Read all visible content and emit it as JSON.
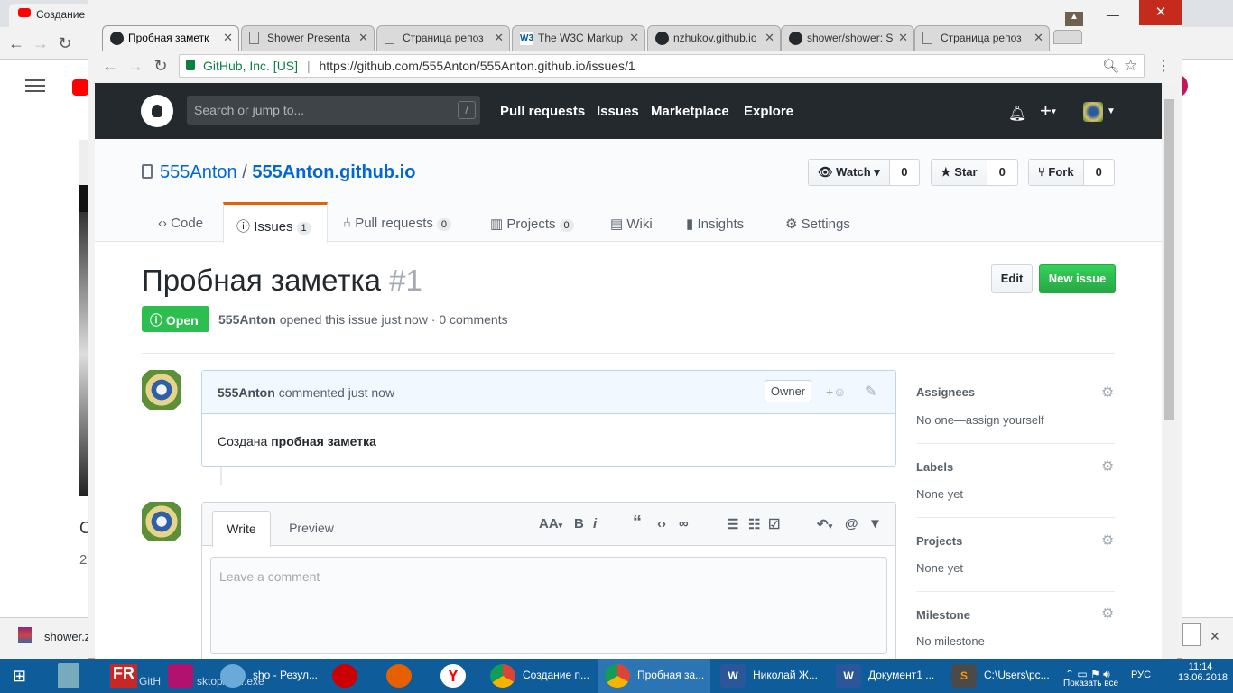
{
  "bg": {
    "tab_title": "Создание",
    "download_file": "shower.z",
    "download_file2": "GitH",
    "download_file3": "sktop/et....exe",
    "left_text_c": "C",
    "left_text_2": "2"
  },
  "window": {
    "tabs": [
      {
        "label": "Пробная заметк",
        "icon": "github-icon"
      },
      {
        "label": "Shower Presenta",
        "icon": "page-icon"
      },
      {
        "label": "Страница репоз",
        "icon": "page-icon"
      },
      {
        "label": "The W3C Markup",
        "icon": "w3c-icon"
      },
      {
        "label": "nzhukov.github.io",
        "icon": "github-icon"
      },
      {
        "label": "shower/shower: S",
        "icon": "github-icon"
      },
      {
        "label": "Страница репоз",
        "icon": "page-icon"
      }
    ],
    "close_symbol": "✕",
    "controls": {
      "minimize": "—",
      "maximize": "☐",
      "close": "✕",
      "user": "👤"
    }
  },
  "omnibox": {
    "secure_label": "GitHub, Inc. [US]",
    "url": "https://github.com/555Anton/555Anton.github.io/issues/1"
  },
  "gh_header": {
    "search_placeholder": "Search or jump to...",
    "slash": "/",
    "nav": [
      "Pull requests",
      "Issues",
      "Marketplace",
      "Explore"
    ]
  },
  "repo": {
    "owner": "555Anton",
    "separator": "/",
    "name": "555Anton.github.io",
    "watch_label": "Watch ▾",
    "watch_count": "0",
    "star_label": "Star",
    "star_count": "0",
    "fork_label": "Fork",
    "fork_count": "0",
    "tabs": [
      {
        "label": "Code",
        "counter": ""
      },
      {
        "label": "Issues",
        "counter": "1"
      },
      {
        "label": "Pull requests",
        "counter": "0"
      },
      {
        "label": "Projects",
        "counter": "0"
      },
      {
        "label": "Wiki",
        "counter": ""
      },
      {
        "label": "Insights",
        "counter": ""
      },
      {
        "label": "Settings",
        "counter": ""
      }
    ]
  },
  "issue": {
    "title": "Пробная заметка",
    "number": "#1",
    "edit_label": "Edit",
    "new_issue_label": "New issue",
    "state": "Open",
    "author": "555Anton",
    "meta_text": "opened this issue just now · 0 comments",
    "comment": {
      "author": "555Anton",
      "time_text": "commented just now",
      "owner_badge": "Owner",
      "body_plain": "Создана",
      "body_bold": "пробная заметка"
    }
  },
  "form": {
    "tab_write": "Write",
    "tab_preview": "Preview",
    "placeholder": "Leave a comment"
  },
  "sidebar": {
    "assignees_title": "Assignees",
    "assignees_value": "No one—assign yourself",
    "labels_title": "Labels",
    "labels_value": "None yet",
    "projects_title": "Projects",
    "projects_value": "None yet",
    "milestone_title": "Milestone",
    "milestone_value": "No milestone"
  },
  "taskbar": {
    "items": [
      {
        "label": "sho - Резул...",
        "color": "#6aa9d8"
      },
      {
        "label": "",
        "color": "#cc0000"
      },
      {
        "label": "",
        "color": "#e66000"
      },
      {
        "label": "",
        "color": "#fff"
      },
      {
        "label": "Создание п...",
        "color": "#fff"
      },
      {
        "label": "Пробная за...",
        "color": "#fff"
      },
      {
        "label": "Николай Ж...",
        "color": "#2b579a"
      },
      {
        "label": "Документ1 ...",
        "color": "#2b579a"
      },
      {
        "label": "C:\\Users\\pc...",
        "color": "#ff9800"
      }
    ],
    "tray_lang": "РУС",
    "time": "11:14",
    "date": "13.06.2018",
    "show_all": "Показать все"
  }
}
